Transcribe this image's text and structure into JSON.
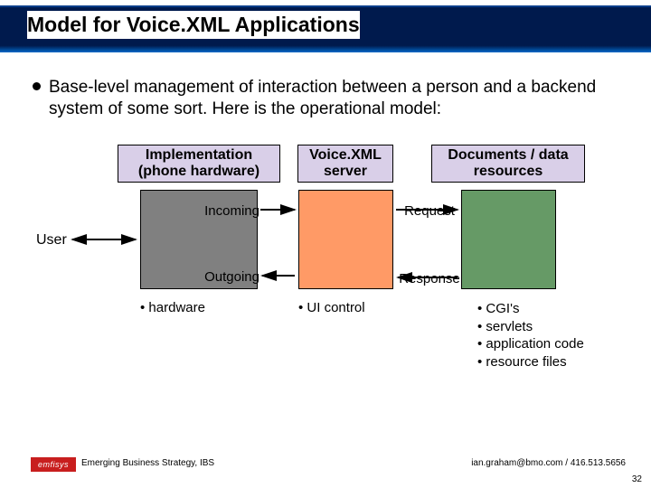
{
  "title": "Model for Voice.XML Applications",
  "bullet": "Base-level management of interaction between a person and a backend system of some sort.  Here is the operational model:",
  "labels": {
    "impl": "Implementation (phone hardware)",
    "vxml": "Voice.XML server",
    "docs": "Documents / data resources"
  },
  "flow": {
    "incoming": "Incoming",
    "outgoing": "Outgoing",
    "request": "Request",
    "response": "Response"
  },
  "user": "User",
  "sub": {
    "hardware": "•  hardware",
    "uicontrol": "•  UI control"
  },
  "resources": [
    "CGI's",
    "servlets",
    "application code",
    "resource files"
  ],
  "footer": {
    "left": "Emerging Business Strategy, IBS",
    "right": "ian.graham@bmo.com / 416.513.5656",
    "logo": "emfisys",
    "num": "32"
  }
}
